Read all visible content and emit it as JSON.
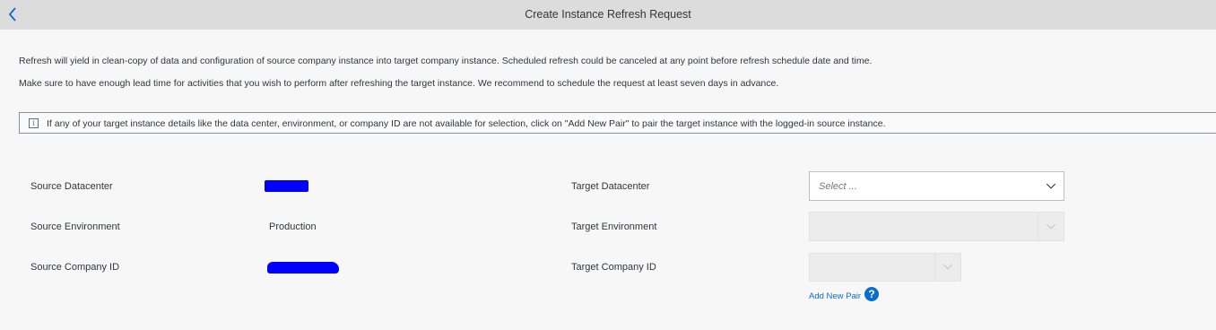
{
  "header": {
    "title": "Create Instance Refresh Request"
  },
  "intro": {
    "line1": "Refresh will yield in clean-copy of data and configuration of source company instance into target company instance. Scheduled refresh could be canceled at any point before refresh schedule date and time.",
    "line2": "Make sure to have enough lead time for activities that you wish to perform after refreshing the target instance. We recommend to schedule the request at least seven days in advance."
  },
  "info": {
    "icon": "info-icon",
    "text": "If any of your target instance details like the data center, environment, or company ID are not available for selection, click on \"Add New Pair\" to pair the target instance with the logged-in source instance."
  },
  "source": {
    "datacenter_label": "Source Datacenter",
    "environment_label": "Source Environment",
    "environment_value": "Production",
    "company_label": "Source Company ID"
  },
  "target": {
    "datacenter_label": "Target Datacenter",
    "datacenter_placeholder": "Select ...",
    "environment_label": "Target Environment",
    "company_label": "Target Company ID",
    "add_pair_label": "Add New Pair",
    "help_glyph": "?"
  },
  "colors": {
    "header_bg": "#dcdcdc",
    "accent": "#0a6ed1",
    "redaction": "#0000ff"
  }
}
